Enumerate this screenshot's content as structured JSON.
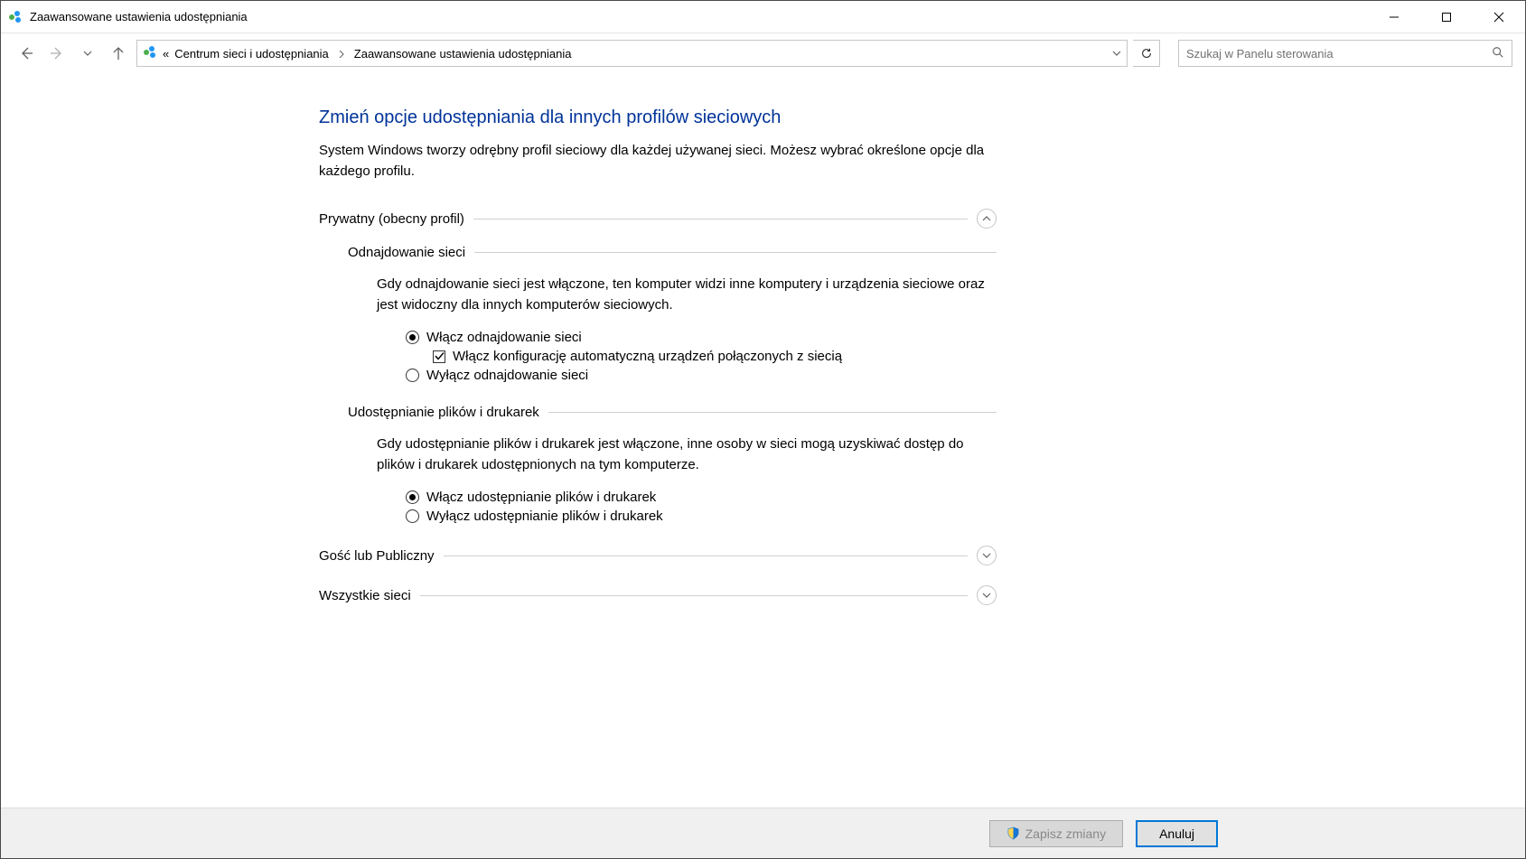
{
  "window": {
    "title": "Zaawansowane ustawienia udostępniania"
  },
  "breadcrumb": {
    "level1": "Centrum sieci i udostępniania",
    "level2": "Zaawansowane ustawienia udostępniania"
  },
  "search": {
    "placeholder": "Szukaj w Panelu sterowania"
  },
  "main": {
    "heading": "Zmień opcje udostępniania dla innych profilów sieciowych",
    "intro": "System Windows tworzy odrębny profil sieciowy dla każdej używanej sieci. Możesz wybrać określone opcje dla każdego profilu."
  },
  "profile_private": {
    "label": "Prywatny (obecny profil)",
    "network_discovery": {
      "label": "Odnajdowanie sieci",
      "desc": "Gdy odnajdowanie sieci jest włączone, ten komputer widzi inne komputery i urządzenia sieciowe oraz jest widoczny dla innych komputerów sieciowych.",
      "radio_on": "Włącz odnajdowanie sieci",
      "checkbox_auto": "Włącz konfigurację automatyczną urządzeń połączonych z siecią",
      "radio_off": "Wyłącz odnajdowanie sieci"
    },
    "file_printer": {
      "label": "Udostępnianie plików i drukarek",
      "desc": "Gdy udostępnianie plików i drukarek jest włączone, inne osoby w sieci mogą uzyskiwać dostęp do plików i drukarek udostępnionych na tym komputerze.",
      "radio_on": "Włącz udostępnianie plików i drukarek",
      "radio_off": "Wyłącz udostępnianie plików i drukarek"
    }
  },
  "profile_guest": {
    "label": "Gość lub Publiczny"
  },
  "profile_all": {
    "label": "Wszystkie sieci"
  },
  "footer": {
    "save": "Zapisz zmiany",
    "cancel": "Anuluj"
  }
}
